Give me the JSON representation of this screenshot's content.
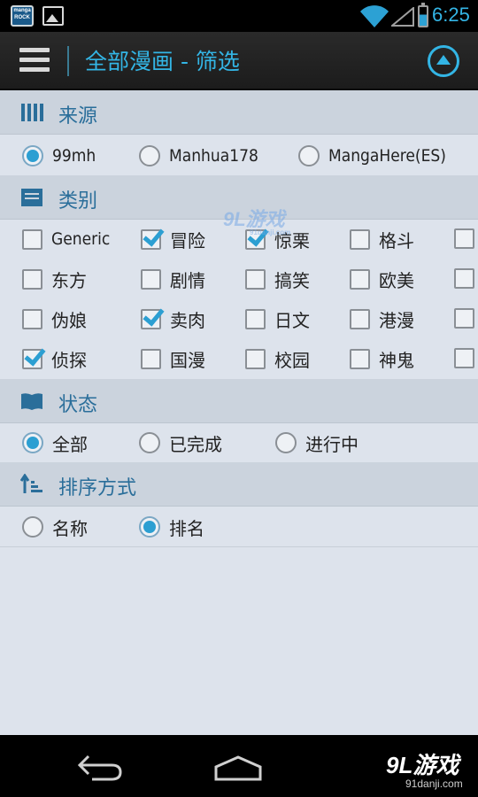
{
  "status_bar": {
    "app_icon_text": "manga ROCK",
    "time": "6:25",
    "battery_level": 0.6
  },
  "action_bar": {
    "title": "全部漫画 - 筛选"
  },
  "sections": {
    "source": {
      "header": "来源",
      "options": [
        "99mh",
        "Manhua178",
        "MangaHere(ES)"
      ],
      "selected": "99mh"
    },
    "category": {
      "header": "类别",
      "rows": [
        [
          {
            "label": "Generic",
            "checked": false
          },
          {
            "label": "冒险",
            "checked": true
          },
          {
            "label": "惊栗",
            "checked": true
          },
          {
            "label": "格斗",
            "checked": false
          }
        ],
        [
          {
            "label": "东方",
            "checked": false
          },
          {
            "label": "剧情",
            "checked": false
          },
          {
            "label": "搞笑",
            "checked": false
          },
          {
            "label": "欧美",
            "checked": false
          }
        ],
        [
          {
            "label": "伪娘",
            "checked": false
          },
          {
            "label": "卖肉",
            "checked": true
          },
          {
            "label": "日文",
            "checked": false
          },
          {
            "label": "港漫",
            "checked": false
          }
        ],
        [
          {
            "label": "侦探",
            "checked": true
          },
          {
            "label": "国漫",
            "checked": false
          },
          {
            "label": "校园",
            "checked": false
          },
          {
            "label": "神鬼",
            "checked": false
          }
        ]
      ]
    },
    "status": {
      "header": "状态",
      "options": [
        "全部",
        "已完成",
        "进行中"
      ],
      "selected": "全部"
    },
    "sort": {
      "header": "排序方式",
      "options": [
        "名称",
        "排名"
      ],
      "selected": "排名"
    }
  },
  "watermark": {
    "text": "9L游戏",
    "sub": "91danji.com"
  },
  "nav_bar": {
    "brand": "9L游戏",
    "brand_sub": "91danji.com"
  },
  "colors": {
    "accent": "#33b5e5",
    "header_text": "#2a6e9a",
    "section_bg": "#cbd3dd",
    "content_bg": "#dde3ec"
  }
}
